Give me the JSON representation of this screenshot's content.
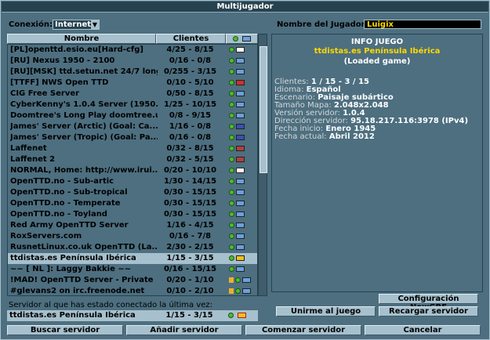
{
  "window": {
    "title": "Multijugador"
  },
  "connection": {
    "label": "Conexión:",
    "value": "Internet"
  },
  "player": {
    "label": "Nombre del Jugador:",
    "value": "Luigix"
  },
  "list": {
    "headers": {
      "name": "Nombre",
      "clients": "Clientes"
    },
    "rows": [
      {
        "name": "[PL]openttd.esio.eu[Hard-cfg]",
        "clients": "4/25 - 8/15",
        "flag": "PL",
        "flag_color": "#ffffff",
        "lock": false
      },
      {
        "name": "[RU] Nexus 1950 - 2100",
        "clients": "0/16 - 0/8",
        "flag": "world",
        "flag_color": "#6aa0e0",
        "lock": false
      },
      {
        "name": "[RU][MSK] ttd.setun.net 24/7 long",
        "clients": "0/255 - 3/15",
        "flag": "world",
        "flag_color": "#6aa0e0",
        "lock": false
      },
      {
        "name": "[TTFF] NWS Open TTD",
        "clients": "0/10 - 5/10",
        "flag": "FR",
        "flag_color": "#d03030",
        "lock": false
      },
      {
        "name": "CIG Free Server",
        "clients": "0/50 - 8/15",
        "flag": "world",
        "flag_color": "#6aa0e0",
        "lock": false
      },
      {
        "name": "CyberKenny's 1.0.4 Server (1950...",
        "clients": "1/25 - 10/15",
        "flag": "world",
        "flag_color": "#6aa0e0",
        "lock": false
      },
      {
        "name": "Doomtree's Long Play doomtree.u...",
        "clients": "0/8 - 9/15",
        "flag": "world",
        "flag_color": "#6aa0e0",
        "lock": false
      },
      {
        "name": "James' Server (Arctic) (Goal: Ca...",
        "clients": "1/16 - 0/8",
        "flag": "UK",
        "flag_color": "#3a4fb0",
        "lock": false
      },
      {
        "name": "James' Server (Tropic) (Goal: Pa...",
        "clients": "0/16 - 0/8",
        "flag": "UK",
        "flag_color": "#3a4fb0",
        "lock": false
      },
      {
        "name": "Laffenet",
        "clients": "0/32 - 8/15",
        "flag": "US",
        "flag_color": "#b04040",
        "lock": false
      },
      {
        "name": "Laffenet 2",
        "clients": "0/32 - 5/15",
        "flag": "US",
        "flag_color": "#b04040",
        "lock": false
      },
      {
        "name": "NORMAL, Home: http://www.irui...",
        "clients": "0/20 - 10/10",
        "flag": "KR",
        "flag_color": "#ffffff",
        "lock": false
      },
      {
        "name": "OpenTTD.no - Sub-artic",
        "clients": "1/30 - 14/15",
        "flag": "world",
        "flag_color": "#6aa0e0",
        "lock": false
      },
      {
        "name": "OpenTTD.no - Sub-tropical",
        "clients": "0/30 - 15/15",
        "flag": "world",
        "flag_color": "#6aa0e0",
        "lock": false
      },
      {
        "name": "OpenTTD.no - Temperate",
        "clients": "0/30 - 15/15",
        "flag": "world",
        "flag_color": "#6aa0e0",
        "lock": false
      },
      {
        "name": "OpenTTD.no - Toyland",
        "clients": "0/30 - 15/15",
        "flag": "world",
        "flag_color": "#6aa0e0",
        "lock": false
      },
      {
        "name": "Red Army OpenTTD Server",
        "clients": "1/16 - 4/15",
        "flag": "world",
        "flag_color": "#6aa0e0",
        "lock": false
      },
      {
        "name": "RoxServers.com",
        "clients": "0/16 - 7/8",
        "flag": "world",
        "flag_color": "#6aa0e0",
        "lock": false
      },
      {
        "name": "RusnetLinux.co.uk OpenTTD (La...",
        "clients": "2/30 - 2/15",
        "flag": "world",
        "flag_color": "#6aa0e0",
        "lock": false
      },
      {
        "name": "ttdistas.es Península Ibérica",
        "clients": "1/15 - 3/15",
        "flag": "ES",
        "flag_color": "#f0c020",
        "lock": false,
        "selected": true
      },
      {
        "name": "~~ [ NL ]: Laggy Bakkie ~~",
        "clients": "0/16 - 15/15",
        "flag": "world",
        "flag_color": "#6aa0e0",
        "lock": false
      },
      {
        "name": "!MAD! OpenTTD Server - Private",
        "clients": "0/20 - 1/10",
        "flag": "world",
        "flag_color": "#6aa0e0",
        "lock": true
      },
      {
        "name": "#glevans2 on irc.freenode.net",
        "clients": "0/10 - 2/10",
        "flag": "world",
        "flag_color": "#6aa0e0",
        "lock": true
      }
    ]
  },
  "last_server": {
    "label": "Servidor al que has estado conectado la última vez:",
    "name": "ttdistas.es Península Ibérica",
    "clients": "1/15 - 3/15"
  },
  "info": {
    "header": "INFO JUEGO",
    "server_name": "ttdistas.es Península Ibérica",
    "status": "(Loaded game)",
    "lines": [
      {
        "k": "Clientes: ",
        "v": "1 / 15 - 3 / 15"
      },
      {
        "k": "Idioma: ",
        "v": "Español"
      },
      {
        "k": "Escenario: ",
        "v": "Paisaje subártico"
      },
      {
        "k": "Tamaño Mapa: ",
        "v": "2.048x2.048"
      },
      {
        "k": "Versión servidor: ",
        "v": "1.0.4"
      },
      {
        "k": "Dirección servidor: ",
        "v": "95.18.217.116:3978 (IPv4)"
      },
      {
        "k": "Fecha inicio: ",
        "v": "Enero 1945"
      },
      {
        "k": "Fecha actual: ",
        "v": "Abril 2012"
      }
    ],
    "newgrf_button": "Configuración NewGRF",
    "join_button": "Unirme al juego",
    "refresh_button": "Recargar servidor"
  },
  "bottom_buttons": {
    "find": "Buscar servidor",
    "add": "Añadir servidor",
    "start": "Comenzar servidor",
    "cancel": "Cancelar"
  },
  "colors": {
    "window_bg": "#4d6f80",
    "button_bg": "#a7c0cd",
    "title_bg": "#27424f",
    "highlight_text": "#ffd800",
    "online_dot": "#4bbd2f"
  }
}
